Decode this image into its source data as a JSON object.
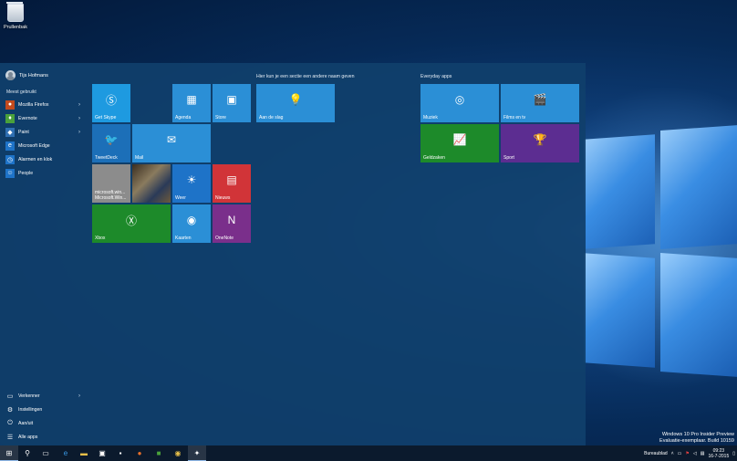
{
  "desktop": {
    "recycle_bin_label": "Prullenbak",
    "watermark_line1": "Windows 10 Pro Insider Preview",
    "watermark_line2": "Evaluatie-exemplaar. Build 10159"
  },
  "start_menu": {
    "user_name": "Tijs Hofmans",
    "most_used_header": "Meest gebruikt",
    "apps": [
      {
        "label": "Mozilla Firefox",
        "icon": "firefox-icon",
        "has_arrow": true,
        "color": "#c24a1e"
      },
      {
        "label": "Evernote",
        "icon": "evernote-icon",
        "has_arrow": true,
        "color": "#4aa13b"
      },
      {
        "label": "Paint",
        "icon": "paint-icon",
        "has_arrow": true,
        "color": "#2f6fb2"
      },
      {
        "label": "Microsoft Edge",
        "icon": "edge-icon",
        "has_arrow": false,
        "color": "#1e73c8"
      },
      {
        "label": "Alarmen en klok",
        "icon": "alarm-clock-icon",
        "has_arrow": false,
        "color": "#1e73c8"
      },
      {
        "label": "People",
        "icon": "people-icon",
        "has_arrow": false,
        "color": "#1e73c8"
      }
    ],
    "bottom": [
      {
        "label": "Verkenner",
        "icon": "folder-icon",
        "has_arrow": true
      },
      {
        "label": "Instellingen",
        "icon": "gear-icon",
        "has_arrow": false
      },
      {
        "label": "Aan/uit",
        "icon": "power-icon",
        "has_arrow": false
      },
      {
        "label": "Alle apps",
        "icon": "list-icon",
        "has_arrow": false
      }
    ],
    "group1_header": "Hier kun je een sectie een andere naam geven",
    "group2_header": "Everyday apps",
    "tiles": {
      "get_skype": "Get Skype",
      "agenda": "Agenda",
      "store": "Store",
      "aan_de_slag": "Aan de slag",
      "tweetdeck": "TweetDeck",
      "mail": "Mail",
      "microsoft_win": "microsoft.win... Microsoft.Win...",
      "weer": "Weer",
      "nieuws": "Nieuws",
      "xbox": "Xbox",
      "kaarten": "Kaarten",
      "onenote": "OneNote",
      "muziek": "Muziek",
      "films": "Films en tv",
      "geldzaken": "Geldzaken",
      "sport": "Sport"
    },
    "colors": {
      "tile_blue": "#2b8fd6",
      "tile_green": "#1d8a2a",
      "tile_red": "#d13438",
      "tile_purple": "#5c2d91",
      "tile_onenote": "#7a2f8b",
      "tile_gray": "#8c8c8c"
    }
  },
  "taskbar": {
    "tray_label": "Bureaublad",
    "time": "09:23",
    "date": "16-7-2015",
    "icons": [
      "start-icon",
      "search-icon",
      "task-view-icon",
      "edge-icon",
      "explorer-icon",
      "store-icon",
      "cmd-icon",
      "firefox-icon",
      "evernote-icon",
      "chrome-icon",
      "app-icon"
    ]
  }
}
